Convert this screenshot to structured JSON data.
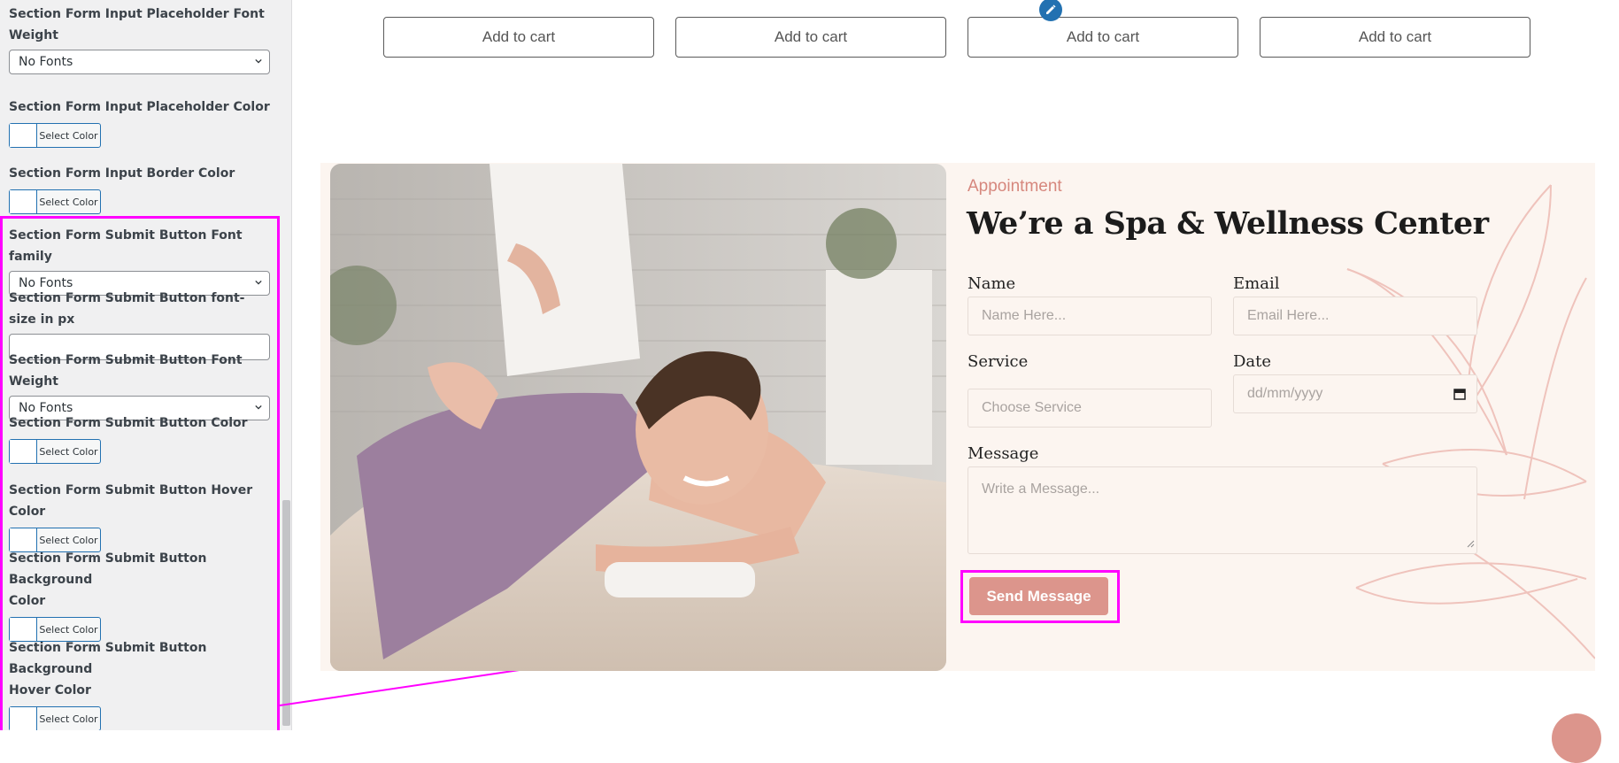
{
  "sidebar": {
    "fields": [
      {
        "label_lines": [
          "Section Form Input Placeholder Font",
          "Weight"
        ],
        "control": "select",
        "value": "No Fonts"
      },
      {
        "label_lines": [
          "Section Form Input Placeholder Color"
        ],
        "control": "color",
        "value": "Select Color"
      },
      {
        "label_lines": [
          "Section Form Input Border Color"
        ],
        "control": "color",
        "value": "Select Color"
      },
      {
        "label_lines": [
          "Section Form Submit Button Font family"
        ],
        "control": "select",
        "value": "No Fonts"
      },
      {
        "label_lines": [
          "Section Form Submit Button font-size in px"
        ],
        "control": "text",
        "value": ""
      },
      {
        "label_lines": [
          "Section Form Submit Button Font Weight"
        ],
        "control": "select",
        "value": "No Fonts"
      },
      {
        "label_lines": [
          "Section Form Submit Button Color"
        ],
        "control": "color",
        "value": "Select Color"
      },
      {
        "label_lines": [
          "Section Form Submit Button Hover Color"
        ],
        "control": "color",
        "value": "Select Color"
      },
      {
        "label_lines": [
          "Section Form Submit Button Background",
          "Color"
        ],
        "control": "color",
        "value": "Select Color"
      },
      {
        "label_lines": [
          "Section Form Submit Button Background",
          "Hover Color"
        ],
        "control": "color",
        "value": "Select Color"
      }
    ]
  },
  "products": {
    "add_to_cart_labels": [
      "Add to cart",
      "Add to cart",
      "Add to cart",
      "Add to cart"
    ]
  },
  "appointment": {
    "eyebrow": "Appointment",
    "heading": "We’re a Spa & Wellness Center",
    "name_label": "Name",
    "name_placeholder": "Name Here...",
    "email_label": "Email",
    "email_placeholder": "Email Here...",
    "service_label": "Service",
    "service_placeholder": "Choose Service",
    "date_label": "Date",
    "date_placeholder": "dd/mm/yyyy",
    "message_label": "Message",
    "message_placeholder": "Write a Message...",
    "submit_label": "Send Message"
  },
  "colors": {
    "accent": "#dc958c",
    "section_bg": "#fcf5f0",
    "highlight": "#ff00ff"
  }
}
